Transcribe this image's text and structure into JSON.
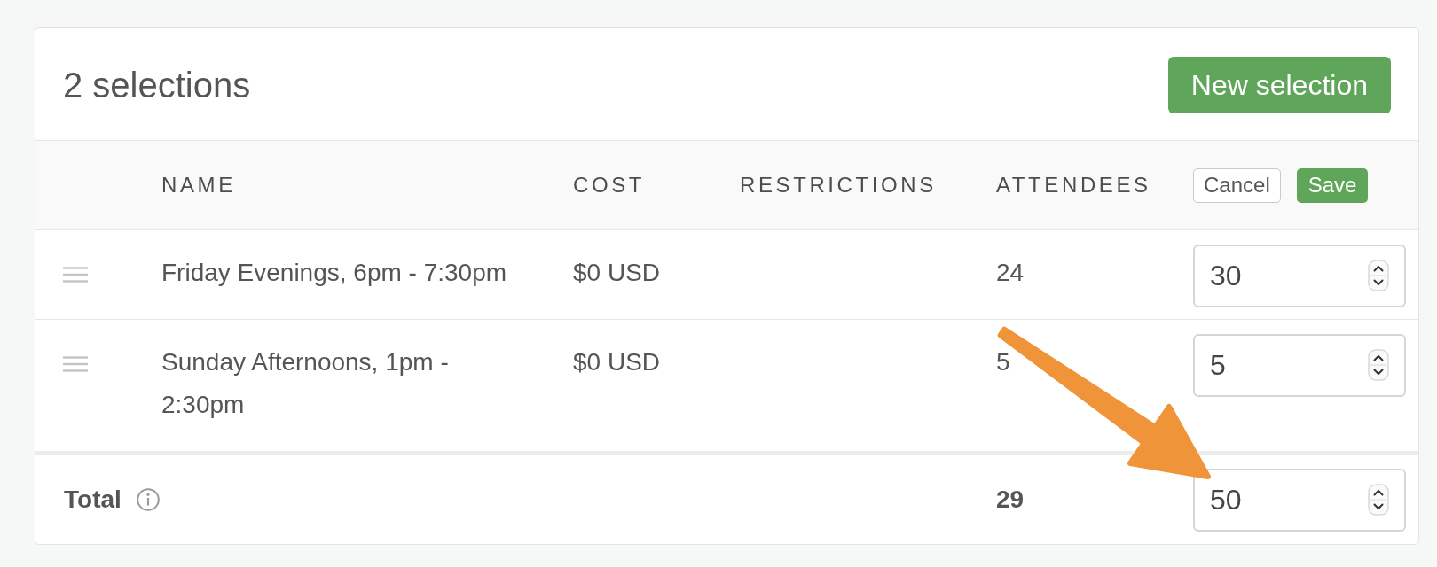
{
  "header": {
    "title": "2 selections",
    "new_button": "New selection"
  },
  "table": {
    "columns": [
      "NAME",
      "COST",
      "RESTRICTIONS",
      "ATTENDEES"
    ],
    "edit_actions": {
      "cancel": "Cancel",
      "save": "Save"
    },
    "rows": [
      {
        "name": "Friday Evenings, 6pm - 7:30pm",
        "cost": "$0 USD",
        "attendees": "24",
        "capacity": "30"
      },
      {
        "name": "Sunday Afternoons, 1pm - 2:30pm",
        "cost": "$0 USD",
        "attendees": "5",
        "capacity": "5"
      }
    ],
    "total": {
      "label": "Total",
      "attendees": "29",
      "capacity": "50"
    }
  }
}
